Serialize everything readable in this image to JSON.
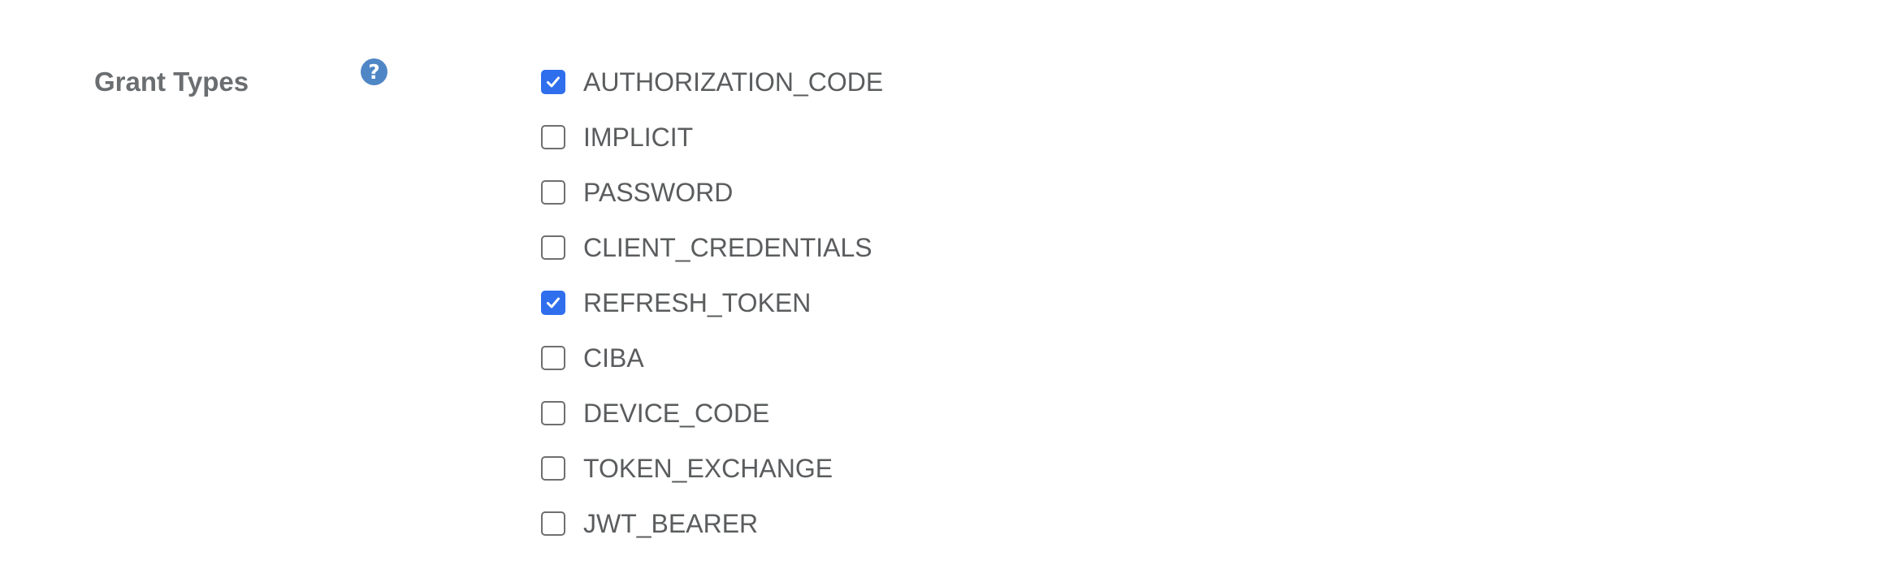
{
  "field": {
    "label": "Grant Types",
    "help_icon": "question-circle-icon",
    "help_color": "#4f86c6"
  },
  "accent_color": "#2f6fed",
  "grant_types": [
    {
      "label": "AUTHORIZATION_CODE",
      "checked": true
    },
    {
      "label": "IMPLICIT",
      "checked": false
    },
    {
      "label": "PASSWORD",
      "checked": false
    },
    {
      "label": "CLIENT_CREDENTIALS",
      "checked": false
    },
    {
      "label": "REFRESH_TOKEN",
      "checked": true
    },
    {
      "label": "CIBA",
      "checked": false
    },
    {
      "label": "DEVICE_CODE",
      "checked": false
    },
    {
      "label": "TOKEN_EXCHANGE",
      "checked": false
    },
    {
      "label": "JWT_BEARER",
      "checked": false
    }
  ]
}
